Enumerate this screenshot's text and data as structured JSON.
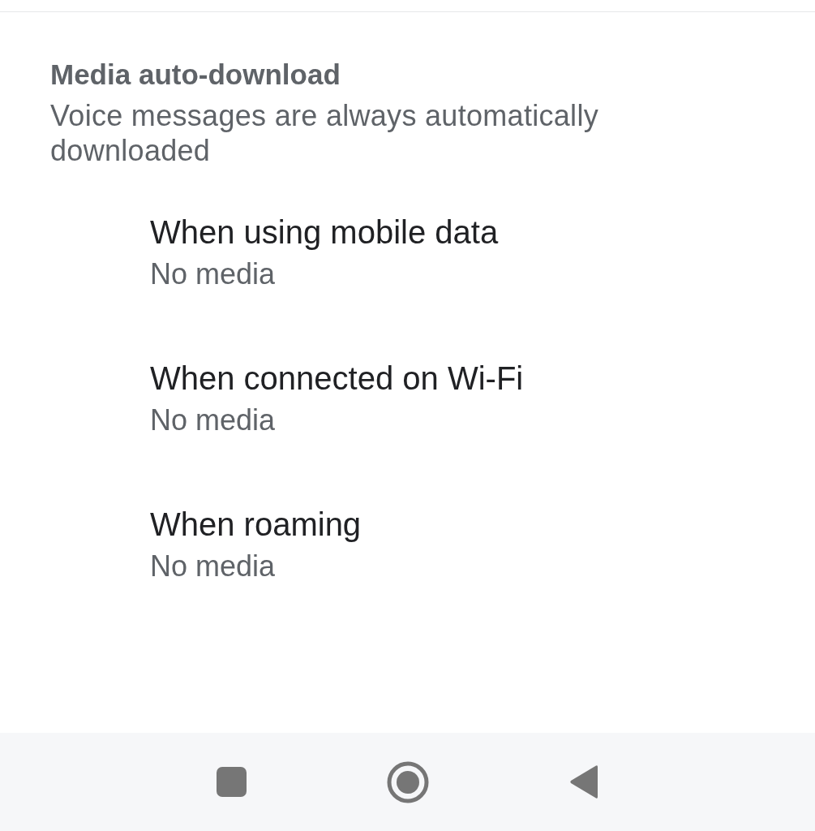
{
  "section": {
    "title": "Media auto-download",
    "subtitle": "Voice messages are always automatically downloaded"
  },
  "options": [
    {
      "title": "When using mobile data",
      "value": "No media"
    },
    {
      "title": "When connected on Wi-Fi",
      "value": "No media"
    },
    {
      "title": "When roaming",
      "value": "No media"
    }
  ]
}
